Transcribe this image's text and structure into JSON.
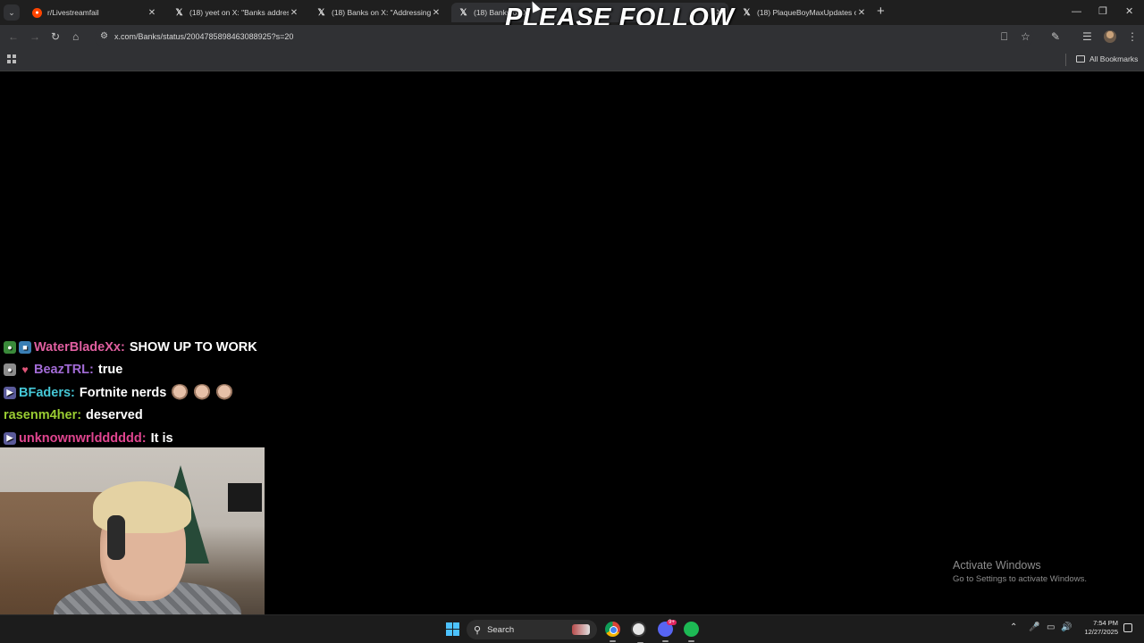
{
  "tabs": [
    {
      "title": "r/Livestreamfail",
      "favicon": "reddit-icon",
      "active": false
    },
    {
      "title": "(18) yeet on X: \"Banks addresse",
      "favicon": "x-logo-icon",
      "active": false
    },
    {
      "title": "(18) Banks on X: \"Addressing e",
      "favicon": "x-logo-icon",
      "active": false
    },
    {
      "title": "(18) Banks on X: \"",
      "favicon": "x-logo-icon",
      "active": true
    },
    {
      "title": "(18) PlaqueBoyMaxUpdates on",
      "favicon": "x-logo-icon",
      "active": false
    }
  ],
  "overlay_text": "PLEASE FOLLOW",
  "address_bar": {
    "url": "x.com/Banks/status/2004785898463088925?s=20"
  },
  "bookmarks": {
    "all_label": "All Bookmarks"
  },
  "chat": [
    {
      "user": "WaterBladeXx:",
      "text": "SHOW UP TO WORK",
      "user_color": "#e05fa0",
      "badges": [
        "b-green",
        "b-blue"
      ]
    },
    {
      "user": "BeazTRL:",
      "text": "true",
      "user_color": "#a26bd6",
      "badges": [
        "b-gray",
        "b-heart"
      ]
    },
    {
      "user": "BFaders:",
      "text": "Fortnite nerds",
      "user_color": "#45c7d6",
      "badges": [
        "b-sub"
      ],
      "emotes": 3
    },
    {
      "user": "rasenm4her:",
      "text": "deserved",
      "user_color": "#9acd32",
      "badges": []
    },
    {
      "user": "unknownwrldddddd:",
      "text": "It is",
      "user_color": "#e0458f",
      "badges": [
        "b-sub"
      ]
    }
  ],
  "watermark": {
    "line1": "Activate Windows",
    "line2": "Go to Settings to activate Windows."
  },
  "taskbar": {
    "search_label": "Search",
    "apps": [
      "windows-start-icon",
      "chrome-icon",
      "obs-icon",
      "discord-icon",
      "spotify-icon"
    ],
    "discord_badge": "9+",
    "time": "7:54 PM",
    "date": "12/27/2025"
  }
}
